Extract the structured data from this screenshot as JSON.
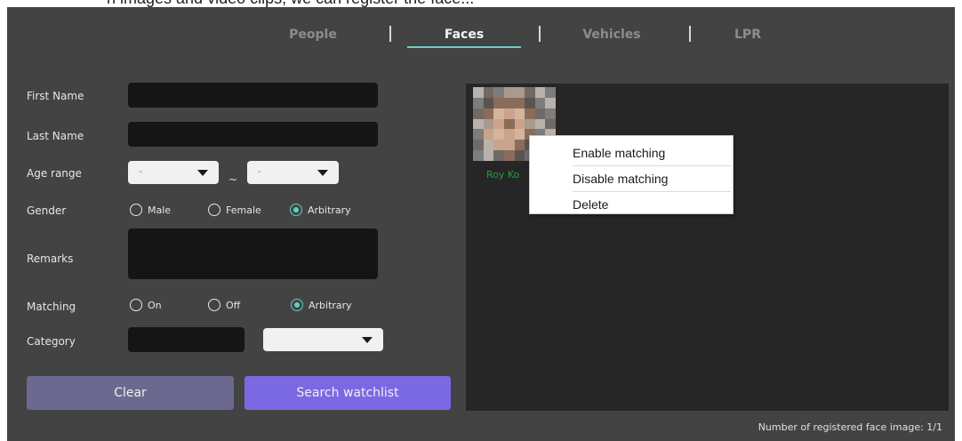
{
  "tabs": [
    "People",
    "Faces",
    "Vehicles",
    "LPR"
  ],
  "active_tab": "Faces",
  "form": {
    "first_name_label": "First Name",
    "last_name_label": "Last Name",
    "age_range_label": "Age range",
    "age_from": "-",
    "age_to": "-",
    "age_separator": "~",
    "gender_label": "Gender",
    "gender_options": [
      "Male",
      "Female",
      "Arbitrary"
    ],
    "gender_selected": "Arbitrary",
    "remarks_label": "Remarks",
    "matching_label": "Matching",
    "matching_options": [
      "On",
      "Off",
      "Arbitrary"
    ],
    "matching_selected": "Arbitrary",
    "category_label": "Category",
    "category_value": ""
  },
  "buttons": {
    "clear": "Clear",
    "search": "Search watchlist"
  },
  "results": {
    "face_name": "Roy Ko",
    "count_text": "Number of registered face image: 1/1"
  },
  "context_menu": [
    "Enable matching",
    "Disable matching",
    "Delete"
  ],
  "colors": {
    "accent": "#5ccfc6",
    "clear_button": "#6b6990",
    "search_button": "#7b69e3",
    "panel_bg": "#434343",
    "results_bg": "#262626",
    "name_green": "#1aa33a"
  }
}
